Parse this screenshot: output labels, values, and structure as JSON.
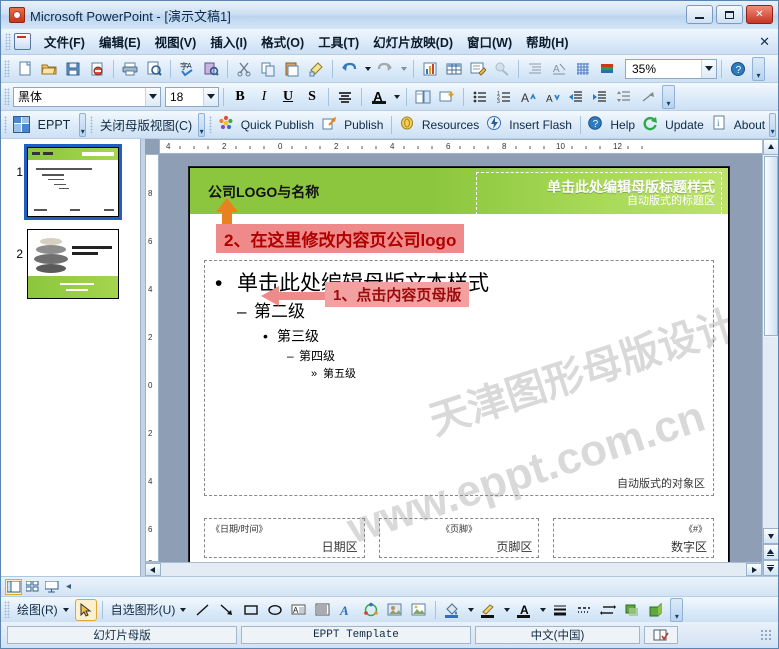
{
  "window": {
    "title": "Microsoft PowerPoint - [演示文稿1]",
    "app_icon": "powerpoint-icon",
    "minimize": "–",
    "maximize": "□",
    "close": "✕",
    "menu_close": "✕"
  },
  "menubar": {
    "items": [
      {
        "label": "文件(F)",
        "name": "menu-file"
      },
      {
        "label": "编辑(E)",
        "name": "menu-edit"
      },
      {
        "label": "视图(V)",
        "name": "menu-view"
      },
      {
        "label": "插入(I)",
        "name": "menu-insert"
      },
      {
        "label": "格式(O)",
        "name": "menu-format"
      },
      {
        "label": "工具(T)",
        "name": "menu-tools"
      },
      {
        "label": "幻灯片放映(D)",
        "name": "menu-slideshow"
      },
      {
        "label": "窗口(W)",
        "name": "menu-window"
      },
      {
        "label": "帮助(H)",
        "name": "menu-help"
      }
    ]
  },
  "standard_toolbar": {
    "zoom_value": "35%",
    "buttons": [
      "new-document-icon",
      "open-folder-icon",
      "save-disk-icon",
      "permission-icon",
      "print-icon",
      "print-preview-icon",
      "spell-check-icon",
      "research-icon",
      "cut-scissors-icon",
      "copy-icon",
      "paste-icon",
      "format-painter-icon",
      "undo-icon",
      "redo-icon",
      "insert-chart-icon",
      "insert-table-icon",
      "insert-diagram-icon",
      "insert-hyperlink-icon",
      "expand-all-icon",
      "show-formatting-icon",
      "show-grid-icon",
      "color-scheme-icon",
      "help-icon"
    ]
  },
  "formatting_toolbar": {
    "font_name": "黑体",
    "font_size": "18",
    "bold": "B",
    "italic": "I",
    "underline": "U",
    "shadow": "S",
    "align": "align-center-icon",
    "font_color": "A",
    "buttons": [
      "design-icon",
      "new-slide-icon",
      "bullets-icon",
      "numbering-icon",
      "increase-font-icon",
      "decrease-font-icon",
      "decrease-indent-icon",
      "increase-indent-icon",
      "line-spacing-icon",
      "more-icon"
    ]
  },
  "eppt_toolbar": {
    "eppt_label": "EPPT",
    "close_master_label": "关闭母版视图(C)",
    "items": [
      {
        "label": "Quick Publish",
        "icon": "quick-publish-icon"
      },
      {
        "label": "Publish",
        "icon": "publish-icon"
      },
      {
        "label": "Resources",
        "icon": "resources-icon"
      },
      {
        "label": "Insert Flash",
        "icon": "insert-flash-icon"
      },
      {
        "label": "Help",
        "icon": "help-circle-icon"
      },
      {
        "label": "Update",
        "icon": "update-refresh-icon"
      },
      {
        "label": "About",
        "icon": "about-info-icon"
      }
    ]
  },
  "slides_pane": {
    "thumbnails": [
      {
        "number": "1",
        "name": "slide-thumbnail-1",
        "selected": true
      },
      {
        "number": "2",
        "name": "slide-thumbnail-2",
        "selected": false
      }
    ]
  },
  "annotations": {
    "step1": "1、点击内容页母版",
    "step2": "2、在这里修改内容页公司logo"
  },
  "rulers": {
    "horizontal_ticks": [
      "4",
      "2",
      "0",
      "2",
      "4",
      "6",
      "8",
      "10",
      "12"
    ],
    "vertical_ticks": [
      "8",
      "6",
      "4",
      "2",
      "0",
      "2",
      "4",
      "6",
      "8"
    ]
  },
  "slide": {
    "logo_text": "公司LOGO与名称",
    "title_placeholder_line1": "单击此处编辑母版标题样式",
    "title_placeholder_line2": "自动版式的标题区",
    "body": {
      "level1": {
        "bullet": "•",
        "text": "单击此处编辑母版文本样式"
      },
      "level2": {
        "bullet": "–",
        "text": "第二级"
      },
      "level3": {
        "bullet": "•",
        "text": "第三级"
      },
      "level4": {
        "bullet": "–",
        "text": "第四级"
      },
      "level5": {
        "bullet": "»",
        "text": "第五级"
      }
    },
    "object_area_label": "自动版式的对象区",
    "footer_placeholders": [
      {
        "tag": "《日期/时间》",
        "zone": "日期区",
        "name": "date-placeholder"
      },
      {
        "tag": "《页脚》",
        "zone": "页脚区",
        "name": "footer-placeholder"
      },
      {
        "tag": "《#》",
        "zone": "数字区",
        "name": "slide-number-placeholder"
      }
    ],
    "watermark": [
      "www.eppt.com.cn",
      "天津图形母版设计公司"
    ]
  },
  "view_buttons": [
    {
      "name": "normal-view-button",
      "active": true
    },
    {
      "name": "slide-sorter-view-button",
      "active": false
    },
    {
      "name": "slideshow-view-button",
      "active": false
    }
  ],
  "drawing_toolbar": {
    "draw_label": "绘图(R)",
    "autoshapes_label": "自选图形(U)",
    "buttons": [
      "select-arrow-icon",
      "line-icon",
      "arrow-icon",
      "rectangle-icon",
      "oval-icon",
      "text-box-icon",
      "vertical-text-box-icon",
      "wordart-icon",
      "diagram-icon",
      "clip-art-icon",
      "picture-icon",
      "fill-color-icon",
      "line-color-icon",
      "font-color-icon",
      "line-style-icon",
      "dash-style-icon",
      "arrow-style-icon",
      "shadow-style-icon",
      "3d-style-icon"
    ]
  },
  "statusbar": {
    "view_mode": "幻灯片母版",
    "design_name": "EPPT Template",
    "language": "中文(中国)",
    "spell_icon": "spell-check-status-icon"
  },
  "colors": {
    "header_green": "#8cc63e",
    "callout_pink": "#ef8a8a",
    "callout_text": "#b00000",
    "annotation_bg": "#f2a0a0",
    "accent_blue": "#1d5fc4"
  }
}
